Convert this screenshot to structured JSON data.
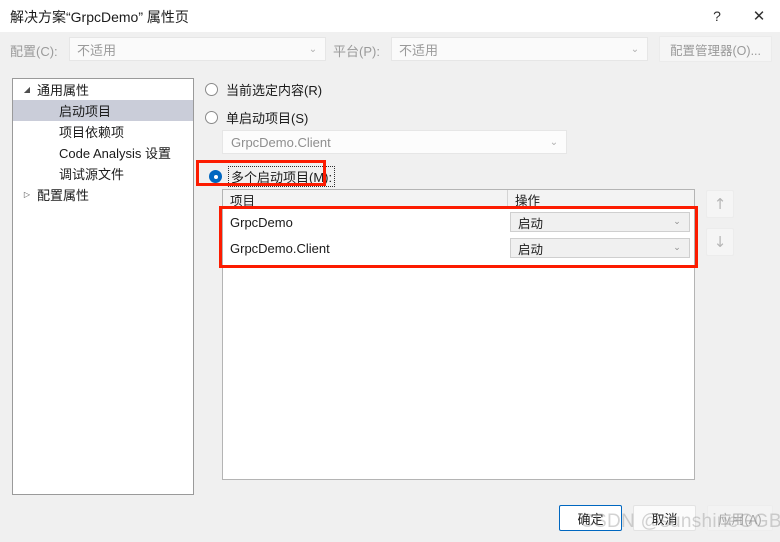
{
  "window": {
    "title": "解决方案“GrpcDemo” 属性页",
    "help_icon": "?",
    "close_icon": "✕"
  },
  "config_bar": {
    "configuration_label": "配置(C):",
    "configuration_value": "不适用",
    "platform_label": "平台(P):",
    "platform_value": "不适用",
    "config_manager_button": "配置管理器(O)..."
  },
  "tree": {
    "items": [
      {
        "label": "通用属性",
        "arrow": "◢",
        "level": 0,
        "selected": false
      },
      {
        "label": "启动项目",
        "arrow": "",
        "level": 1,
        "selected": true
      },
      {
        "label": "项目依赖项",
        "arrow": "",
        "level": 1,
        "selected": false
      },
      {
        "label": "Code Analysis 设置",
        "arrow": "",
        "level": 1,
        "selected": false
      },
      {
        "label": "调试源文件",
        "arrow": "",
        "level": 1,
        "selected": false
      },
      {
        "label": "配置属性",
        "arrow": "▷",
        "level": 0,
        "selected": false
      }
    ]
  },
  "startup": {
    "current_selection_label": "当前选定内容(R)",
    "single_startup_label": "单启动项目(S)",
    "single_startup_value": "GrpcDemo.Client",
    "multiple_startup_label": "多个启动项目(M):",
    "selected_option": "multiple"
  },
  "grid": {
    "columns": [
      "项目",
      "操作"
    ],
    "rows": [
      {
        "project": "GrpcDemo",
        "action": "启动"
      },
      {
        "project": "GrpcDemo.Client",
        "action": "启动"
      }
    ]
  },
  "move_buttons": {
    "up_icon": "↑",
    "down_icon": "↓"
  },
  "footer": {
    "ok": "确定",
    "cancel": "取消",
    "apply": "应用(A)"
  },
  "watermark": "CSDN @sunshineGGB",
  "colors": {
    "accent": "#0067c0",
    "annotation_red": "#fc1b00",
    "tree_selection": "#cacdd9",
    "dialog_bg": "#f0f0f0"
  }
}
